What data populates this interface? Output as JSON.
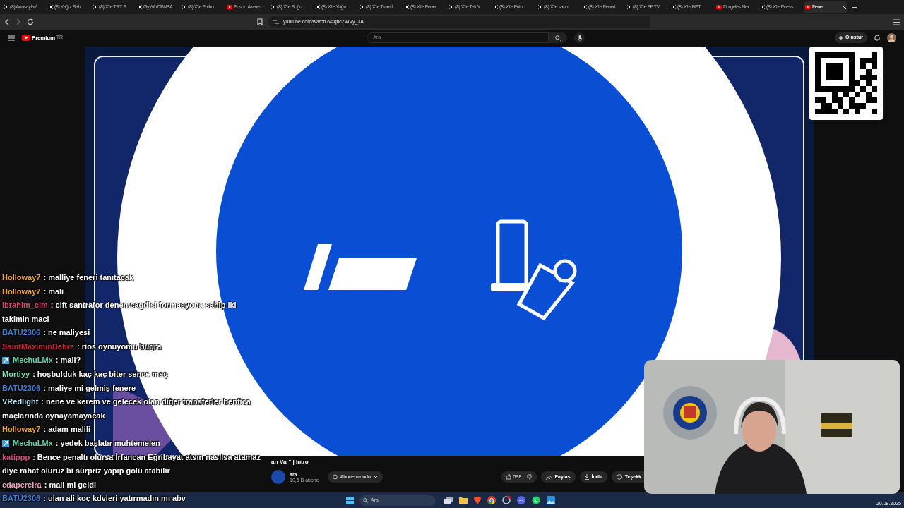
{
  "browser": {
    "tabs": [
      {
        "title": "(8) Anasayfa /",
        "kind": "x",
        "selected": false
      },
      {
        "title": "(8) Yağız Sab",
        "kind": "x",
        "selected": false
      },
      {
        "title": "(8) X'te TRT S",
        "kind": "x",
        "selected": false
      },
      {
        "title": "GyyVuZAWBA",
        "kind": "x",
        "selected": false
      },
      {
        "title": "(8) X'te Futbo",
        "kind": "x",
        "selected": false
      },
      {
        "title": "Edson Álvarez",
        "kind": "youtube",
        "selected": false
      },
      {
        "title": "(8) X'te Boğu",
        "kind": "x",
        "selected": false
      },
      {
        "title": "(8) X'te Yağız",
        "kind": "x",
        "selected": false
      },
      {
        "title": "(8) X'te Transf",
        "kind": "x",
        "selected": false
      },
      {
        "title": "(8) X'te Fener",
        "kind": "x",
        "selected": false
      },
      {
        "title": "(8) X'te Tek Y",
        "kind": "x",
        "selected": false
      },
      {
        "title": "(8) X'te Futbo",
        "kind": "x",
        "selected": false
      },
      {
        "title": "(8) X'te sarıh",
        "kind": "x",
        "selected": false
      },
      {
        "title": "(8) X'te Feneri",
        "kind": "x",
        "selected": false
      },
      {
        "title": "(8) X'te FF TV",
        "kind": "x",
        "selected": false
      },
      {
        "title": "(8) X'te BPT",
        "kind": "x",
        "selected": false
      },
      {
        "title": "Dorgeles Ner",
        "kind": "youtube",
        "selected": false
      },
      {
        "title": "(8) X'te Eness",
        "kind": "x",
        "selected": false
      },
      {
        "title": "Fener",
        "kind": "youtube",
        "selected": true
      }
    ],
    "url": "youtube.com/watch?v=qflcZWVy_3A"
  },
  "youtube": {
    "logo": "Premium",
    "region": "TR",
    "search": {
      "placeholder": "Ara"
    },
    "create_button": "Oluştur",
    "video_title": "arı Var\" | Intro",
    "channel": {
      "name": "ara",
      "subscribers": "10,5 B abone"
    },
    "subscribe_button": "Abone olundu",
    "likes": "598",
    "share_button": "Paylaş",
    "download_button": "İndir",
    "thanks_button": "Teşekk"
  },
  "chat": [
    {
      "user": "Holloway7",
      "color": "#f5a623",
      "badge": false,
      "text": ": malliye feneri tanıtacak"
    },
    {
      "user": "Holloway7",
      "color": "#f5a623",
      "badge": false,
      "text": ": mali"
    },
    {
      "user": "ibrahim_cim",
      "color": "#d9486e",
      "badge": false,
      "text": ": cift santrafor denen cagdisi formasyona sahip iki takimin maci"
    },
    {
      "user": "BATU2306",
      "color": "#3b7fd9",
      "badge": false,
      "text": ": ne maliyesi"
    },
    {
      "user": "SaintMaximinDehre",
      "color": "#d81b3c",
      "badge": false,
      "text": ": rios oynuyomu bugra"
    },
    {
      "user": "MechuLMx",
      "color": "#5fd3a8",
      "badge": true,
      "text": ": mali?"
    },
    {
      "user": "Mortiyy",
      "color": "#7ee0b5",
      "badge": false,
      "text": ": hoşbulduk kaç kaç biter sence maç"
    },
    {
      "user": "BATU2306",
      "color": "#3b7fd9",
      "badge": false,
      "text": ": maliye mi gelmiş fenere"
    },
    {
      "user": "VRedlight",
      "color": "#b8e0f0",
      "badge": false,
      "text": ": nene ve kerem ve gelecek olan diğer transferler benfica maçlarında oynayamayacak"
    },
    {
      "user": "Holloway7",
      "color": "#f5a623",
      "badge": false,
      "text": ": adam malili"
    },
    {
      "user": "MechuLMx",
      "color": "#5fd3a8",
      "badge": true,
      "text": ": yedek başlatır muhtemelen"
    },
    {
      "user": "katippp",
      "color": "#e0457b",
      "badge": false,
      "text": ": Bence penaltı olursa İrfancan Eğribayat atsın nasılsa atamaz diye rahat oluruz bi sürpriz yapıp golü atabilir"
    },
    {
      "user": "edapereira",
      "color": "#f2a1b8",
      "badge": false,
      "text": ": mali mi geldi"
    },
    {
      "user": "BATU2306",
      "color": "#3b7fd9",
      "badge": false,
      "text": ": ulan ali koç kdvleri yatırmadın mı abv"
    }
  ],
  "taskbar": {
    "search": {
      "placeholder": "Ara"
    },
    "date": "20.08.2025"
  }
}
